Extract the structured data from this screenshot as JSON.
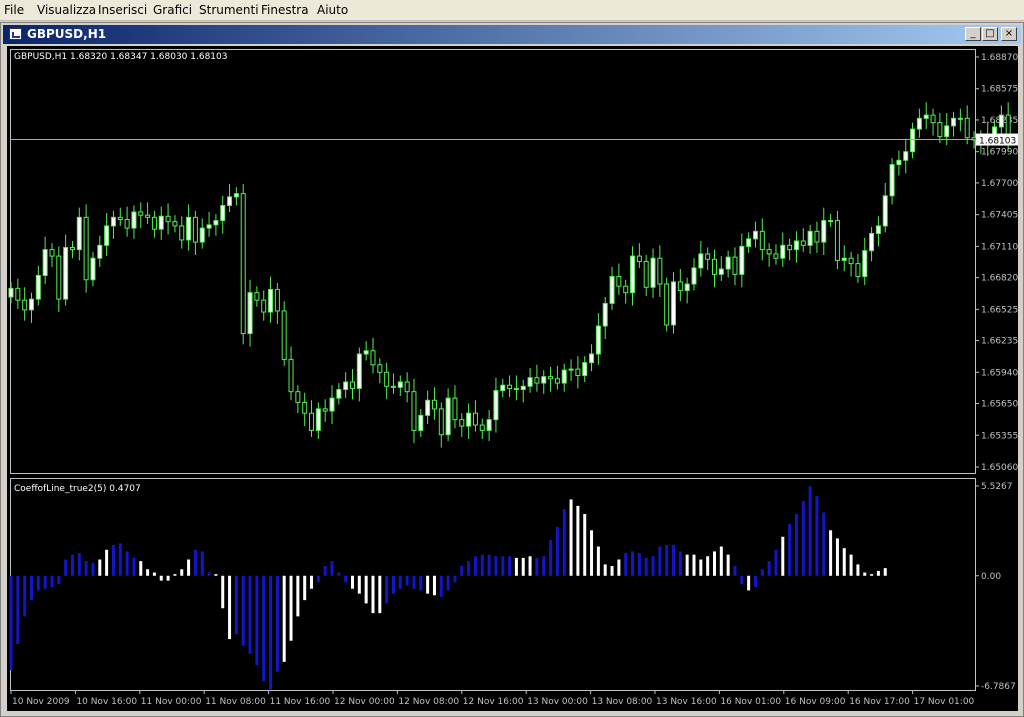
{
  "menu": [
    "File",
    "Visualizza",
    "Inserisci",
    "Grafici",
    "Strumenti",
    "Finestra",
    "Aiuto"
  ],
  "window": {
    "title": "GBPUSD,H1",
    "minimize_glyph": "_",
    "maximize_glyph": "□",
    "close_glyph": "×"
  },
  "colors": {
    "background": "#000000",
    "candle_bull": "#ffffff",
    "candle_bear": "#000000",
    "wick": "#55ee55",
    "grid": "#c0c0c0",
    "hist_blue": "#1414c8",
    "hist_white": "#ffffff"
  },
  "chart_data": [
    {
      "type": "candlestick",
      "title": "GBPUSD,H1 1.68320 1.68347 1.68030 1.68103",
      "price_line": 1.68103,
      "price_line_label": "1.68103",
      "y_ticks": [
        "1.68870",
        "1.68575",
        "1.68285",
        "1.67990",
        "1.67700",
        "1.67405",
        "1.67110",
        "1.66820",
        "1.66525",
        "1.66235",
        "1.65940",
        "1.65650",
        "1.65355",
        "1.65060"
      ],
      "y_tick_values": [
        1.6887,
        1.68575,
        1.68285,
        1.6799,
        1.677,
        1.67405,
        1.6711,
        1.6682,
        1.66525,
        1.66235,
        1.6594,
        1.6565,
        1.65355,
        1.6506
      ],
      "ylim": [
        1.6506,
        1.6887
      ],
      "close": [
        1.6672,
        1.6661,
        1.6652,
        1.6662,
        1.6684,
        1.6708,
        1.6702,
        1.6662,
        1.671,
        1.6708,
        1.6738,
        1.668,
        1.67,
        1.6712,
        1.673,
        1.6738,
        1.6736,
        1.6728,
        1.6743,
        1.674,
        1.6738,
        1.6727,
        1.6739,
        1.6734,
        1.673,
        1.6717,
        1.6738,
        1.6715,
        1.6728,
        1.6731,
        1.6735,
        1.6749,
        1.6757,
        1.676,
        1.663,
        1.6668,
        1.6661,
        1.665,
        1.6671,
        1.6651,
        1.6606,
        1.6576,
        1.6566,
        1.6556,
        1.654,
        1.656,
        1.6558,
        1.657,
        1.6578,
        1.6585,
        1.6579,
        1.6611,
        1.6614,
        1.6601,
        1.6594,
        1.6581,
        1.658,
        1.6585,
        1.6576,
        1.654,
        1.6554,
        1.6568,
        1.656,
        1.6536,
        1.657,
        1.655,
        1.6544,
        1.6556,
        1.6545,
        1.654,
        1.655,
        1.6577,
        1.6582,
        1.6579,
        1.6578,
        1.6581,
        1.6589,
        1.6584,
        1.659,
        1.6588,
        1.6584,
        1.6596,
        1.6597,
        1.6591,
        1.6603,
        1.6611,
        1.6637,
        1.6658,
        1.6683,
        1.6674,
        1.6668,
        1.6702,
        1.6697,
        1.6673,
        1.67,
        1.6676,
        1.6638,
        1.6678,
        1.667,
        1.6676,
        1.6691,
        1.6704,
        1.6699,
        1.6685,
        1.669,
        1.6701,
        1.6685,
        1.6711,
        1.6718,
        1.6725,
        1.6708,
        1.6704,
        1.67,
        1.6712,
        1.6708,
        1.6716,
        1.6712,
        1.6725,
        1.6715,
        1.6735,
        1.6735,
        1.6698,
        1.67,
        1.6695,
        1.6683,
        1.6707,
        1.6723,
        1.673,
        1.6758,
        1.6787,
        1.6791,
        1.6799,
        1.682,
        1.683,
        1.6833,
        1.6826,
        1.6813,
        1.6823,
        1.683,
        1.683,
        1.6812,
        1.681,
        1.6807,
        1.6815,
        1.6822,
        1.6833,
        1.681
      ],
      "x_ticks": [
        "10 Nov 2009",
        "10 Nov 16:00",
        "11 Nov 00:00",
        "11 Nov 08:00",
        "11 Nov 16:00",
        "12 Nov 00:00",
        "12 Nov 08:00",
        "12 Nov 16:00",
        "13 Nov 00:00",
        "13 Nov 08:00",
        "13 Nov 16:00",
        "16 Nov 01:00",
        "16 Nov 09:00",
        "16 Nov 17:00",
        "17 Nov 01:00"
      ]
    },
    {
      "type": "bar",
      "title": "CoeffofLine_true2(5) 0.4707",
      "y_ticks": [
        "5.5267",
        "0.00",
        "-6.7867"
      ],
      "ylim": [
        -6.7867,
        5.5267
      ],
      "values": [
        -5.8,
        -4.2,
        -2.5,
        -1.5,
        -0.9,
        -0.8,
        -0.7,
        -0.5,
        1.0,
        1.3,
        1.4,
        0.9,
        0.8,
        1.0,
        1.6,
        1.9,
        2.0,
        1.5,
        1.1,
        0.9,
        0.4,
        0.2,
        -0.3,
        -0.3,
        0.1,
        0.4,
        1.0,
        1.6,
        1.5,
        0.2,
        0.1,
        -2.0,
        -3.9,
        -3.6,
        -4.3,
        -4.8,
        -5.5,
        -6.5,
        -7.0,
        -5.9,
        -5.3,
        -4.0,
        -2.5,
        -1.5,
        -0.8,
        -0.4,
        0.6,
        0.9,
        0.2,
        -0.4,
        -0.8,
        -1.1,
        -1.7,
        -2.3,
        -2.3,
        -1.7,
        -1.1,
        -0.8,
        -0.6,
        -0.8,
        -0.9,
        -1.1,
        -1.2,
        -1.3,
        -0.9,
        -0.4,
        0.6,
        0.9,
        1.2,
        1.3,
        1.3,
        1.2,
        1.2,
        1.2,
        1.1,
        1.1,
        1.2,
        1.1,
        1.2,
        2.2,
        3.0,
        4.1,
        4.7,
        4.3,
        3.8,
        2.8,
        1.8,
        0.7,
        0.6,
        1.0,
        1.4,
        1.5,
        1.4,
        1.1,
        1.2,
        1.8,
        1.9,
        1.9,
        1.5,
        1.3,
        1.3,
        1.0,
        1.2,
        1.5,
        1.8,
        1.3,
        0.6,
        -0.5,
        -0.9,
        -0.7,
        0.4,
        0.9,
        1.6,
        2.4,
        3.2,
        3.8,
        4.6,
        5.5,
        4.9,
        3.9,
        2.8,
        2.3,
        1.7,
        1.3,
        0.7,
        0.2,
        0.1,
        0.3,
        0.47
      ],
      "colors": "BBBBBBBBBBBBBWWBBBBWWWWWWWWBBBWWWBBBBBBBWWWWWBBBBBWWWWWBBBBBBWWBBBBBBBBBBBWWWBBBBBWWWWWWWWBBBBBBBBBWWWWWWWBBWBBBBWBBBBBBWWWWWWWWWWWW"
    }
  ]
}
